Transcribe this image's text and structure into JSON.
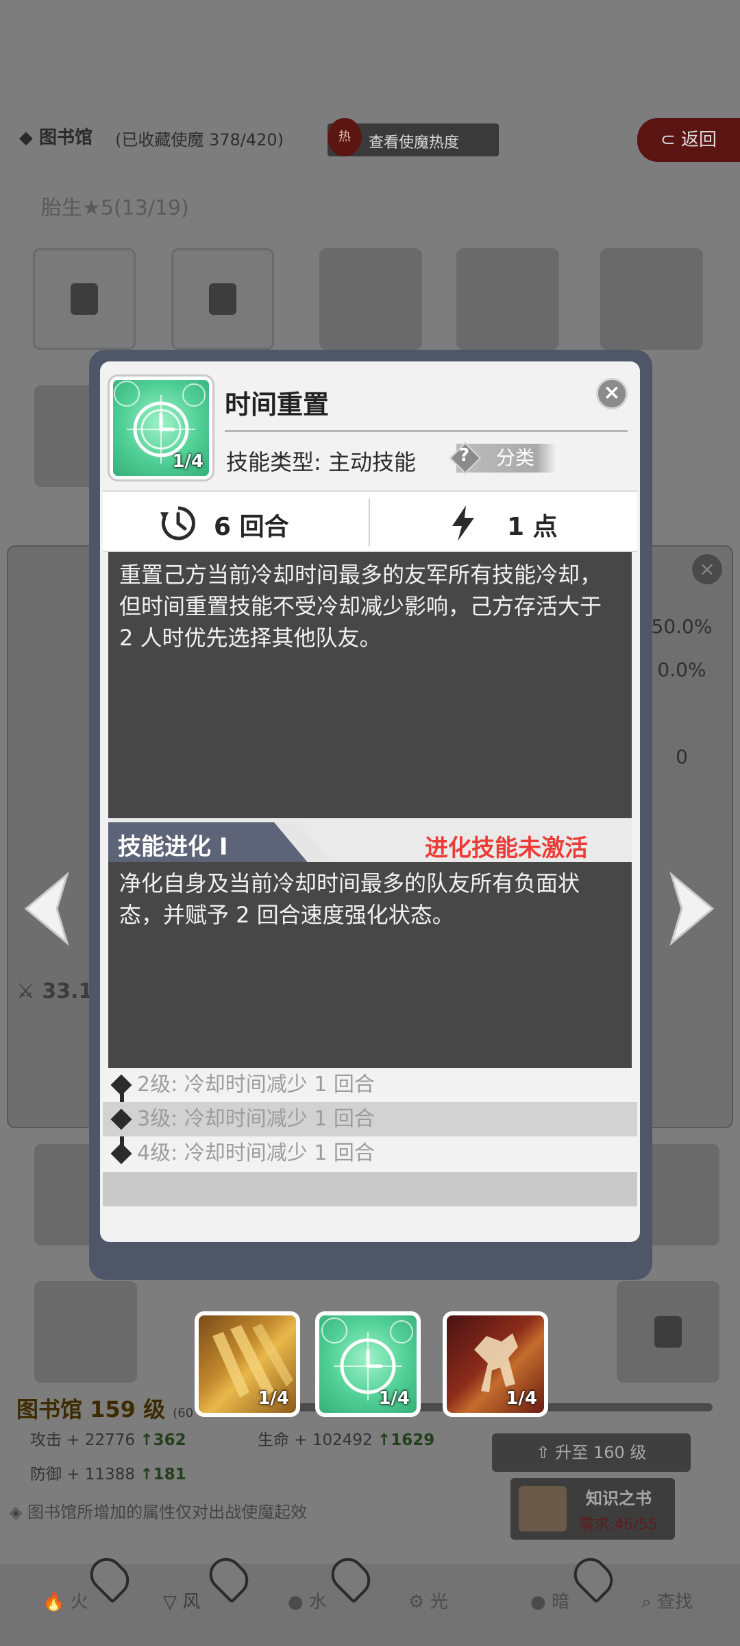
{
  "background": {
    "library_title": "图书馆",
    "library_count": "(已收藏使魔 378/420)",
    "heat_badge": "热",
    "heat_button": "查看使魔热度",
    "back_button": "返回",
    "rank_label": "胎生★5(13/19)",
    "right_panel_values": [
      "50.0%",
      "0.0%",
      "0"
    ],
    "side_attack": "33.1",
    "library_level": "图书馆 159 级",
    "level_paren": "(60",
    "stats": {
      "attack_label": "攻击 + 22776",
      "attack_up": "362",
      "hp_label": "生命 + 102492",
      "hp_up": "1629",
      "defense_label": "防御 + 11388",
      "defense_up": "181"
    },
    "upgrade_button": "升至 160 级",
    "book_name": "知识之书",
    "book_need": "需求:46/55",
    "note": "图书馆所增加的属性仅对出战使魔起效",
    "tabs": [
      "火",
      "风",
      "水",
      "光",
      "暗",
      "查找"
    ]
  },
  "modal": {
    "skill_name": "时间重置",
    "icon_count": "1/4",
    "skill_type": "技能类型: 主动技能",
    "category_button": "分类",
    "category_q": "?",
    "close": "×",
    "cooldown": "6 回合",
    "cost": "1 点",
    "description": "重置己方当前冷却时间最多的友军所有技能冷却，但时间重置技能不受冷却减少影响，己方存活大于 2 人时优先选择其他队友。",
    "evolution_label": "技能进化 Ⅰ",
    "evolution_status": "进化技能未激活",
    "evolution_description": "净化自身及当前冷却时间最多的队友所有负面状态，并赋予 2 回合速度强化状态。",
    "levels": [
      "2级: 冷却时间减少 1 回合",
      "3级: 冷却时间减少 1 回合",
      "4级: 冷却时间减少 1 回合"
    ]
  },
  "skills": [
    {
      "name": "gold-skill",
      "count": "1/4"
    },
    {
      "name": "time-reset-skill",
      "count": "1/4"
    },
    {
      "name": "red-skill",
      "count": "1/4"
    }
  ]
}
